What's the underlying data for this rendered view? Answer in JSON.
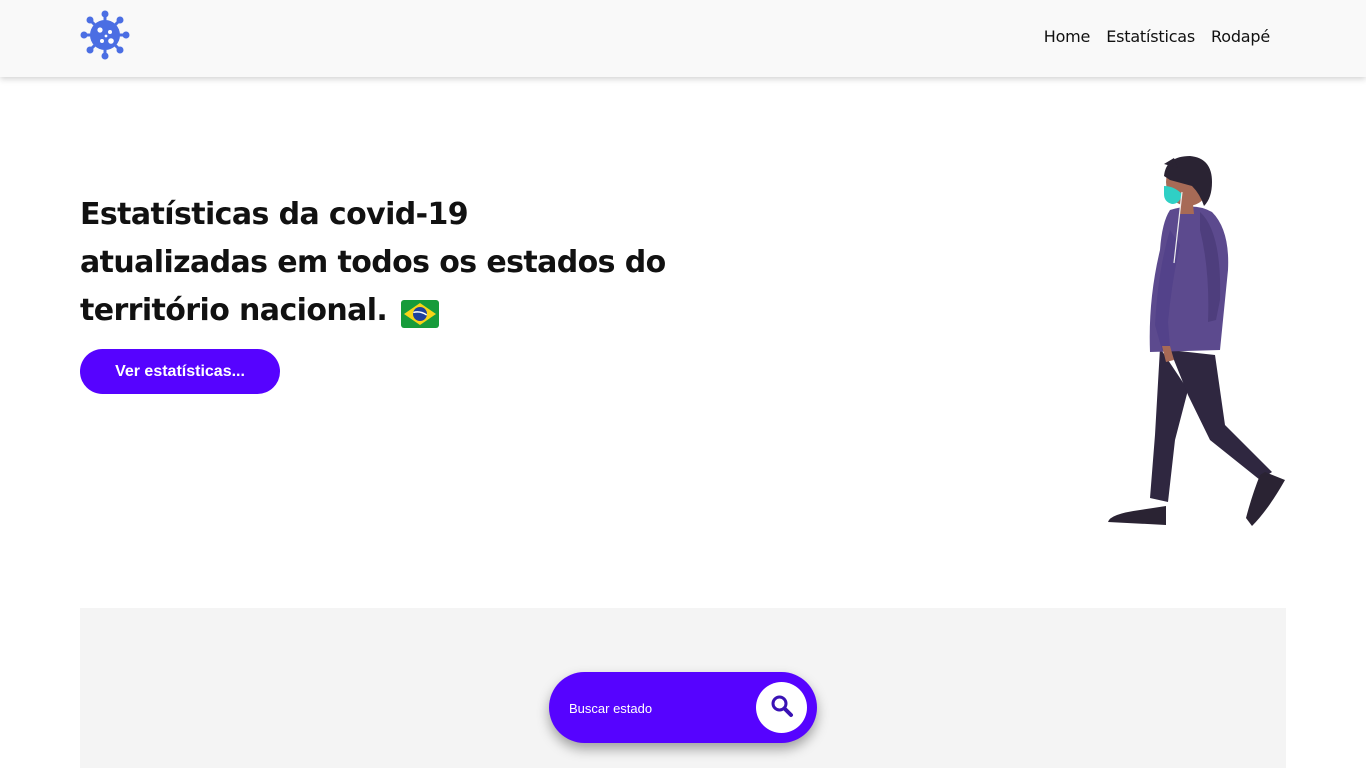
{
  "nav": {
    "logo_icon": "virus-icon",
    "links": [
      "Home",
      "Estatísticas",
      "Rodapé"
    ]
  },
  "hero": {
    "title_lines": [
      "Estatísticas da covid-19",
      "atualizadas em todos os estados do",
      "território nacional."
    ],
    "flag_icon": "brazil-flag-icon",
    "button_label": "Ver estatísticas...",
    "illustration": "person-walking-with-mask-illustration"
  },
  "search": {
    "placeholder": "Buscar estado",
    "value": "",
    "button_icon": "search-icon"
  },
  "colors": {
    "accent": "#5603ff",
    "logo": "#4b6ee3",
    "navbar_bg": "#f9f9f9",
    "section_bg": "#f4f4f4"
  }
}
